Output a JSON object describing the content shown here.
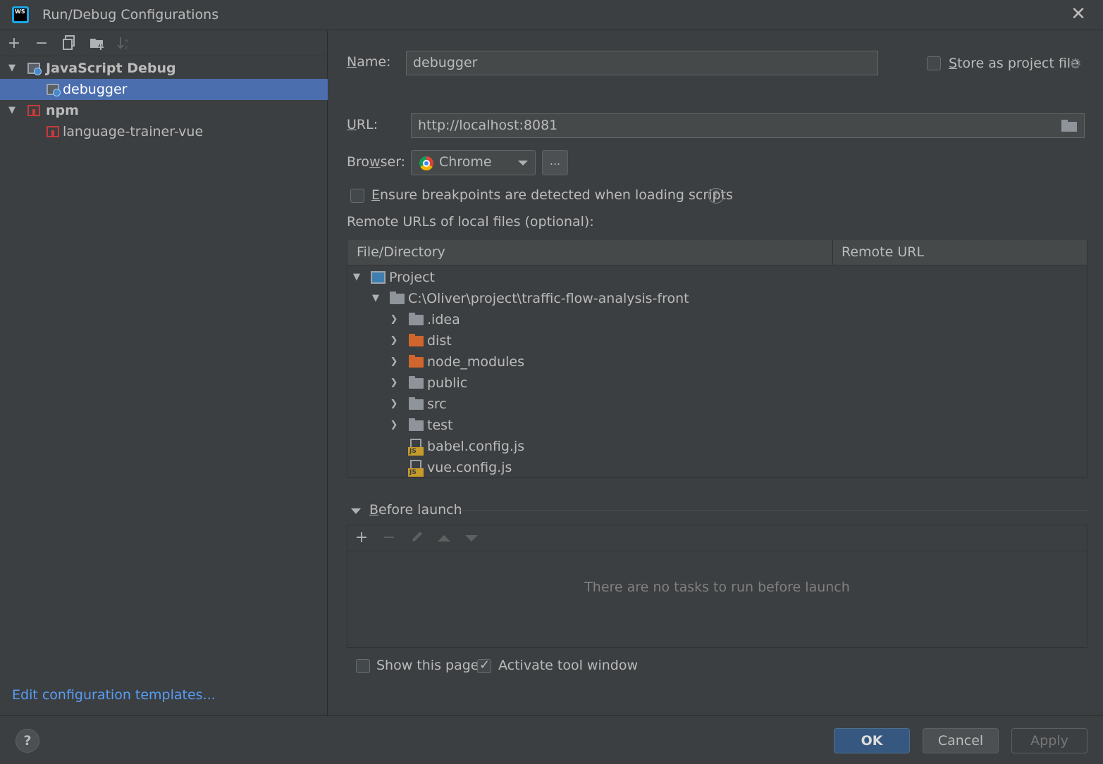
{
  "window": {
    "title": "Run/Debug Configurations",
    "logo_text": "WS"
  },
  "toolbar": {
    "icons": [
      "add-icon",
      "remove-icon",
      "copy-icon",
      "new-folder-icon",
      "sort-icon"
    ]
  },
  "tree": {
    "items": [
      {
        "label": "JavaScript Debug",
        "type": "group"
      },
      {
        "label": "debugger",
        "type": "config"
      },
      {
        "label": "npm",
        "type": "group"
      },
      {
        "label": "language-trainer-vue",
        "type": "config"
      }
    ]
  },
  "edit_templates_link": "Edit configuration templates...",
  "form": {
    "name_label_first": "N",
    "name_label_rest": "ame:",
    "name_value": "debugger",
    "store_label_first": "S",
    "store_label_rest": "tore as project file",
    "url_label_first": "U",
    "url_label_rest": "RL:",
    "url_value": "http://localhost:8081",
    "browser_label_a": "Bro",
    "browser_label_u": "w",
    "browser_label_b": "ser:",
    "browser_value": "Chrome",
    "browser_more": "...",
    "ensure_label_first": "E",
    "ensure_label_rest": "nsure breakpoints are detected when loading scripts",
    "remote_urls_label": "Remote URLs of local files (optional):"
  },
  "mapping_table": {
    "headers": [
      "File/Directory",
      "Remote URL"
    ],
    "rows": [
      {
        "label": "Project",
        "icon": "project-icon"
      },
      {
        "label": "C:\\Oliver\\project\\traffic-flow-analysis-front",
        "icon": "folder-icon"
      },
      {
        "label": ".idea",
        "icon": "folder-icon"
      },
      {
        "label": "dist",
        "icon": "excluded-folder-icon"
      },
      {
        "label": "node_modules",
        "icon": "excluded-folder-icon"
      },
      {
        "label": "public",
        "icon": "folder-icon"
      },
      {
        "label": "src",
        "icon": "folder-icon"
      },
      {
        "label": "test",
        "icon": "folder-icon"
      },
      {
        "label": "babel.config.js",
        "icon": "js-file-icon"
      },
      {
        "label": "vue.config.js",
        "icon": "js-file-icon"
      }
    ]
  },
  "before_launch": {
    "title_first": "B",
    "title_rest": "efore launch",
    "empty_text": "There are no tasks to run before launch",
    "show_page_label": "Show this page",
    "activate_label": "Activate tool window",
    "show_page_checked": false,
    "activate_checked": true
  },
  "buttons": {
    "ok": "OK",
    "cancel": "Cancel",
    "apply": "Apply",
    "help": "?"
  },
  "colors": {
    "selection": "#4b6eaf",
    "link": "#589df6",
    "primary_button": "#365880",
    "background": "#3c3f41"
  }
}
